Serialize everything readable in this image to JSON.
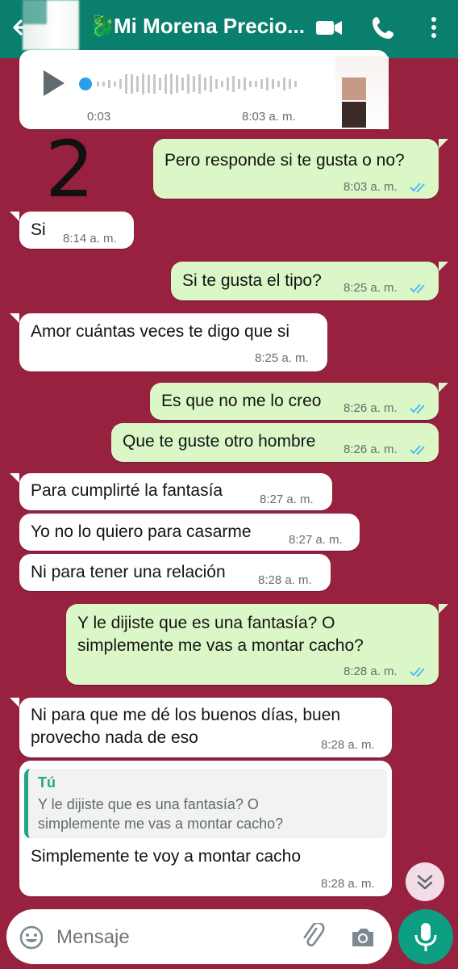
{
  "header": {
    "title": "Mi Morena Precio...",
    "title_emoji": "🐉"
  },
  "voice_note": {
    "duration": "0:03",
    "time": "8:03 a. m."
  },
  "annotation": "2",
  "messages": [
    {
      "side": "out",
      "text": "Pero responde si te gusta o no?",
      "time": "8:03 a. m."
    },
    {
      "side": "in",
      "text": "Si",
      "time": "8:14 a. m."
    },
    {
      "side": "out",
      "text": "Si te gusta el tipo?",
      "time": "8:25 a. m."
    },
    {
      "side": "in",
      "text": "Amor cuántas veces te digo que si",
      "time": "8:25 a. m."
    },
    {
      "side": "out",
      "text": "Es que no me lo creo",
      "time": "8:26 a. m."
    },
    {
      "side": "out",
      "text": "Que te guste otro hombre",
      "time": "8:26 a. m."
    },
    {
      "side": "in",
      "text": "Para cumplirté la fantasía",
      "time": "8:27 a. m."
    },
    {
      "side": "in",
      "text": "Yo no lo quiero para casarme",
      "time": "8:27 a. m."
    },
    {
      "side": "in",
      "text": "Ni para tener una relación",
      "time": "8:28 a. m."
    },
    {
      "side": "out",
      "line1": "Y le dijiste que es una fantasía? O",
      "line2": "simplemente me vas a montar cacho?",
      "time": "8:28 a. m."
    },
    {
      "side": "in",
      "line1": "Ni para que me dé los buenos días, buen",
      "line2": "provecho nada de eso",
      "time": "8:28 a. m."
    },
    {
      "side": "in",
      "quote_author": "Tú",
      "quote_line1": "Y le dijiste que es una fantasía? O",
      "quote_line2": "simplemente me vas a montar cacho?",
      "text": "Simplemente te voy a montar cacho",
      "time": "8:28 a. m."
    }
  ],
  "composer": {
    "placeholder": "Mensaje"
  },
  "colors": {
    "header": "#0a7f6e",
    "background": "#97213f",
    "outgoing": "#dbf7c7",
    "incoming": "#ffffff",
    "read_ticks": "#53bdeb",
    "accent": "#0c9d82"
  },
  "icons": [
    "back-arrow-icon",
    "video-call-icon",
    "phone-icon",
    "more-vert-icon",
    "play-icon",
    "emoji-icon",
    "attach-icon",
    "camera-icon",
    "mic-icon",
    "double-chevron-down-icon",
    "double-check-icon"
  ]
}
